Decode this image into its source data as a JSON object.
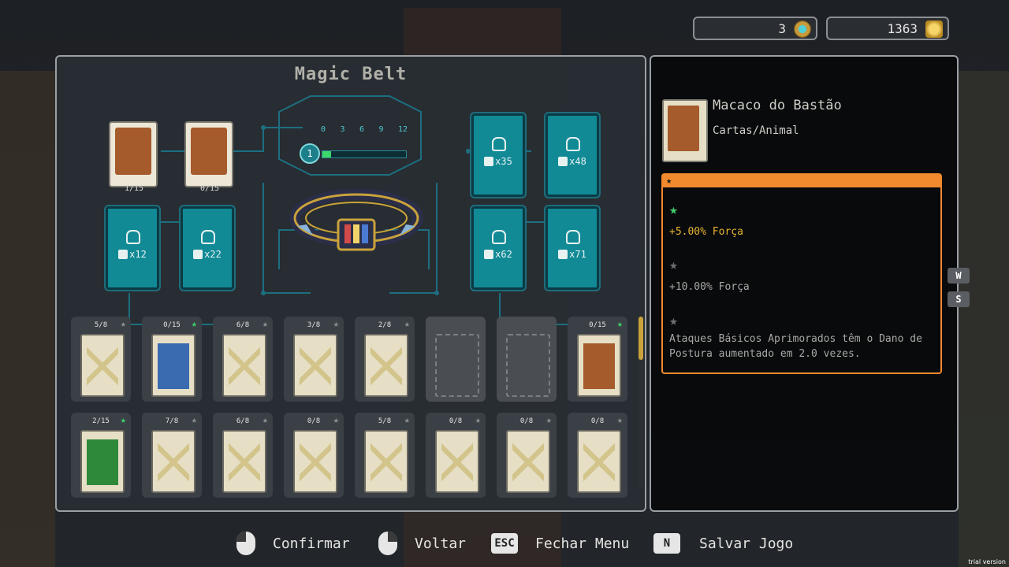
{
  "currency": {
    "gems": "3",
    "coins": "1363"
  },
  "belt": {
    "title": "Magic Belt",
    "level": "1",
    "level_progress": 0.1,
    "ticks": [
      "0",
      "3",
      "6",
      "9",
      "12"
    ],
    "equipped": [
      {
        "count": "1/15"
      },
      {
        "count": "0/15"
      }
    ],
    "locked_slots": [
      {
        "count": "x12"
      },
      {
        "count": "x22"
      },
      {
        "count": "x35"
      },
      {
        "count": "x48"
      },
      {
        "count": "x62"
      },
      {
        "count": "x71"
      }
    ]
  },
  "cards_row1": [
    {
      "count": "5/8",
      "star": "grey",
      "type": "back"
    },
    {
      "count": "0/15",
      "star": "green",
      "type": "art"
    },
    {
      "count": "6/8",
      "star": "grey",
      "type": "back"
    },
    {
      "count": "3/8",
      "star": "grey",
      "type": "back"
    },
    {
      "count": "2/8",
      "star": "grey",
      "type": "back"
    },
    {
      "count": "",
      "star": "",
      "type": "empty"
    },
    {
      "count": "",
      "star": "",
      "type": "empty"
    },
    {
      "count": "0/15",
      "star": "green",
      "type": "art"
    }
  ],
  "cards_row2": [
    {
      "count": "2/15",
      "star": "green",
      "type": "monster"
    },
    {
      "count": "7/8",
      "star": "grey",
      "type": "back"
    },
    {
      "count": "6/8",
      "star": "grey",
      "type": "back"
    },
    {
      "count": "0/8",
      "star": "grey",
      "type": "back"
    },
    {
      "count": "5/8",
      "star": "grey",
      "type": "back"
    },
    {
      "count": "0/8",
      "star": "grey",
      "type": "back"
    },
    {
      "count": "0/8",
      "star": "grey",
      "type": "back"
    },
    {
      "count": "0/8",
      "star": "grey",
      "type": "back"
    }
  ],
  "info": {
    "name": "Macaco do Bastão",
    "category": "Cartas/Animal",
    "bonuses": [
      {
        "text": "+5.00% Força",
        "active": true
      },
      {
        "text": "+10.00% Força",
        "active": false
      },
      {
        "text": "Ataques Básicos Aprimorados têm o Dano de Postura aumentado em 2.0 vezes.",
        "active": false
      }
    ]
  },
  "side_keys": [
    "W",
    "S"
  ],
  "footer": {
    "confirm": "Confirmar",
    "back": "Voltar",
    "esc_key": "ESC",
    "close_menu": "Fechar Menu",
    "n_key": "N",
    "save": "Salvar Jogo"
  },
  "watermark": "trial version",
  "colors": {
    "accent_orange": "#f08a2e",
    "slot_teal": "#118a96",
    "star_green": "#3ed06a",
    "bonus_gold": "#e8b432"
  }
}
